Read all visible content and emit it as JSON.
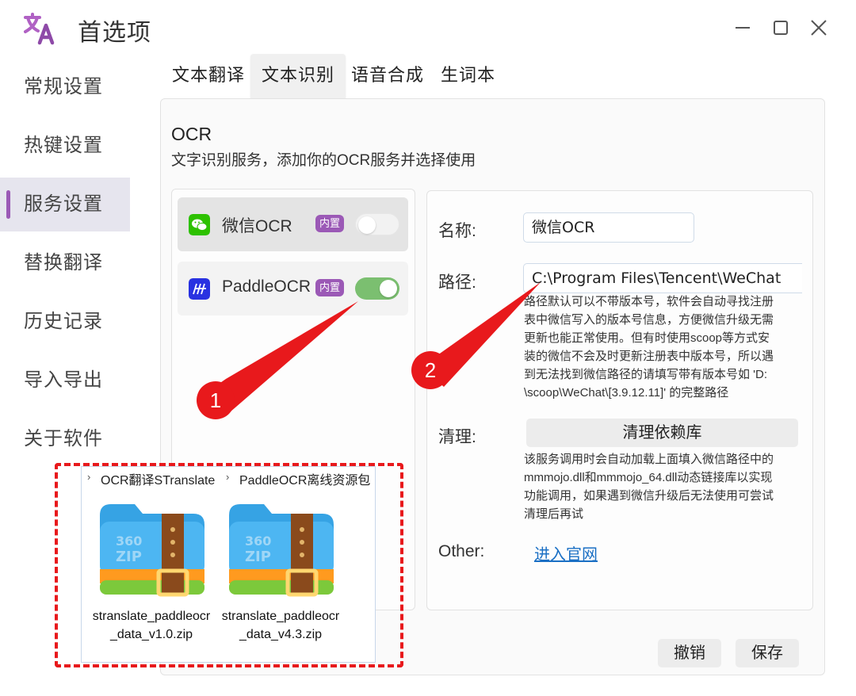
{
  "window": {
    "title": "首选项"
  },
  "sidebar": {
    "items": [
      {
        "label": "常规设置"
      },
      {
        "label": "热键设置"
      },
      {
        "label": "服务设置",
        "active": true
      },
      {
        "label": "替换翻译"
      },
      {
        "label": "历史记录"
      },
      {
        "label": "导入导出"
      },
      {
        "label": "关于软件"
      }
    ]
  },
  "tabs": [
    {
      "label": "文本翻译"
    },
    {
      "label": "文本识别",
      "active": true
    },
    {
      "label": "语音合成"
    },
    {
      "label": "生词本"
    }
  ],
  "section": {
    "title": "OCR",
    "description": "文字识别服务，添加你的OCR服务并选择使用"
  },
  "services": [
    {
      "name": "微信OCR",
      "badge": "内置",
      "enabled": false,
      "selected": true
    },
    {
      "name": "PaddleOCR",
      "badge": "内置",
      "enabled": true,
      "selected": false
    }
  ],
  "detail": {
    "name_label": "名称:",
    "name_value": "微信OCR",
    "path_label": "路径:",
    "path_value": "C:\\Program Files\\Tencent\\WeChat",
    "path_help": [
      "路径默认可以不带版本号，软件会自动寻找注册",
      "表中微信写入的版本号信息，方便微信升级无需",
      "更新也能正常使用。但有时使用scoop等方式安",
      "装的微信不会及时更新注册表中版本号，所以遇",
      "到无法找到微信路径的请填写带有版本号如 'D:",
      "\\scoop\\WeChat\\[3.9.12.11]' 的完整路径"
    ],
    "clean_label": "清理:",
    "clean_button": "清理依赖库",
    "clean_help": [
      "该服务调用时会自动加载上面填入微信路径中的",
      "mmmojo.dll和mmmojo_64.dll动态链接库以实现",
      "功能调用，如果遇到微信升级后无法使用可尝试",
      "清理后再试"
    ],
    "other_label": "Other:",
    "other_link": "进入官网"
  },
  "footer": {
    "cancel": "撤销",
    "save": "保存"
  },
  "explorer": {
    "breadcrumb": [
      "OCR翻译STranslate",
      "PaddleOCR离线资源包"
    ],
    "files": [
      {
        "name": "stranslate_paddleocr_data_v1.0.zip",
        "icon": "zip-archive-icon"
      },
      {
        "name": "stranslate_paddleocr_data_v4.3.zip",
        "icon": "zip-archive-icon"
      }
    ],
    "zip_icon_text": [
      "360",
      "ZIP"
    ]
  },
  "annotations": {
    "marker1": "1",
    "marker2": "2"
  },
  "colors": {
    "accent": "#9b59b6",
    "toggle_on": "#7bbf70",
    "link": "#1a6fc4",
    "annotation": "#e8191c"
  }
}
